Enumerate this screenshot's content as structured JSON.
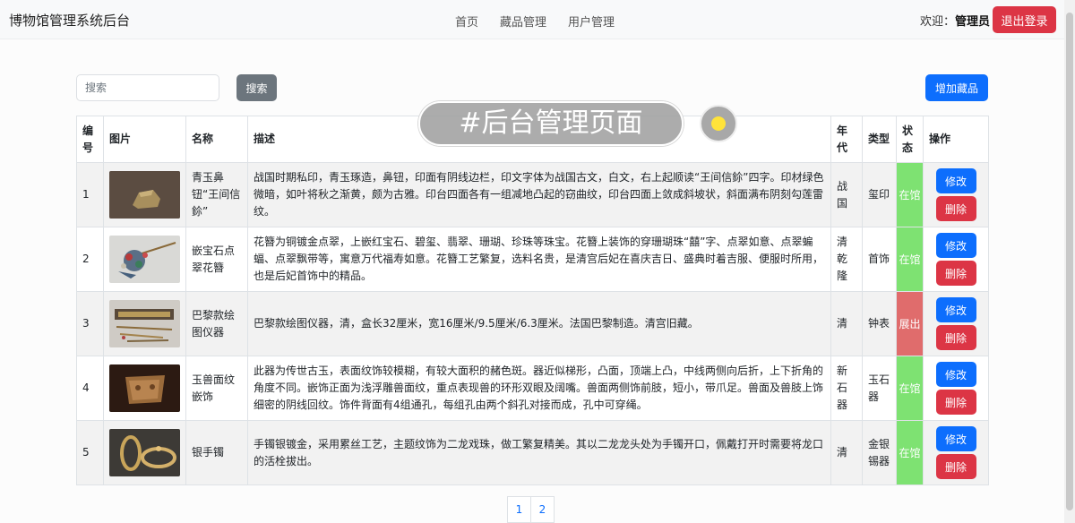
{
  "app": {
    "title": "博物馆管理系统后台"
  },
  "nav": {
    "items": [
      "首页",
      "藏品管理",
      "用户管理"
    ]
  },
  "user": {
    "welcome_label": "欢迎：",
    "name": "管理员",
    "logout_label": "退出登录"
  },
  "toolbar": {
    "search_placeholder": "搜索",
    "search_value": "",
    "search_button": "搜索",
    "add_button": "增加藏品"
  },
  "table": {
    "headers": {
      "id": "编号",
      "image": "图片",
      "name": "名称",
      "desc": "描述",
      "era": "年代",
      "type": "类型",
      "status": "状态",
      "actions": "操作"
    },
    "edit_label": "修改",
    "delete_label": "删除",
    "rows": [
      {
        "id": "1",
        "name": "青玉鼻钮“王间信鉩”",
        "desc": "战国时期私印，青玉琢造，鼻钮，印面有阴线边栏，印文字体为战国古文，白文，右上起顺读“王间信鉩”四字。印材绿色微暗，如叶将秋之渐黄，颇为古雅。印台四面各有一组减地凸起的窃曲纹，印台四面上敛成斜坡状，斜面满布阴刻勾莲雷纹。",
        "era": "战国",
        "type": "玺印",
        "status": "在馆",
        "status_code": "in"
      },
      {
        "id": "2",
        "name": "嵌宝石点翠花簪",
        "desc": "花簪为铜镀金点翠，上嵌红宝石、碧玺、翡翠、珊瑚、珍珠等珠宝。花簪上装饰的穿珊瑚珠“囍”字、点翠如意、点翠蝙蝠、点翠飘带等，寓意万代福寿如意。花簪工艺繁复，选料名贵，是清宫后妃在喜庆吉日、盛典时着吉服、便服时所用，也是后妃首饰中的精品。",
        "era": "清乾隆",
        "type": "首饰",
        "status": "在馆",
        "status_code": "in"
      },
      {
        "id": "3",
        "name": "巴黎款绘图仪器",
        "desc": "巴黎款绘图仪器，清，盒长32厘米，宽16厘米/9.5厘米/6.3厘米。法国巴黎制造。清宫旧藏。",
        "era": "清",
        "type": "钟表",
        "status": "展出",
        "status_code": "out"
      },
      {
        "id": "4",
        "name": "玉兽面纹嵌饰",
        "desc": "此器为传世古玉，表面纹饰较模糊，有较大面积的赭色斑。器近似梯形，凸面，顶端上凸，中线两侧向后折，上下折角的角度不同。嵌饰正面为浅浮雕兽面纹，重点表现兽的环形双眼及阔嘴。兽面两侧饰前肢，短小，带爪足。兽面及兽肢上饰细密的阴线回纹。饰件背面有4组通孔，每组孔由两个斜孔对接而成，孔中可穿绳。",
        "era": "新石器",
        "type": "玉石器",
        "status": "在馆",
        "status_code": "in"
      },
      {
        "id": "5",
        "name": "银手镯",
        "desc": "手镯银镀金，采用累丝工艺，主题纹饰为二龙戏珠，做工繁复精美。其以二龙龙头处为手镯开口，佩戴打开时需要将龙口的活栓拔出。",
        "era": "清",
        "type": "金银锡器",
        "status": "在馆",
        "status_code": "in"
      }
    ]
  },
  "pagination": {
    "pages": [
      "1",
      "2"
    ]
  },
  "overlay": {
    "label": "#后台管理页面"
  },
  "colors": {
    "primary": "#0d6efd",
    "danger": "#dc3545",
    "secondary": "#6c757d",
    "status_in": "#7ee272",
    "status_out": "#e06c6c"
  }
}
